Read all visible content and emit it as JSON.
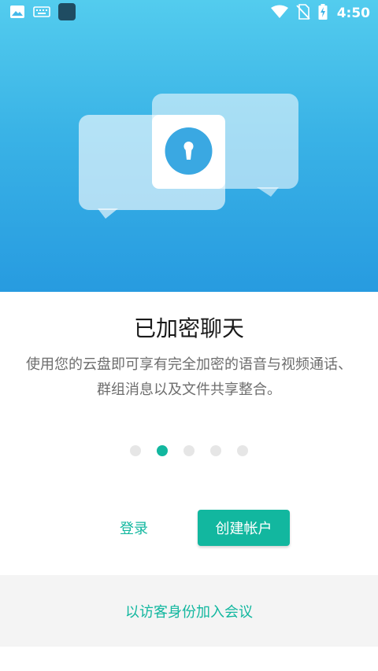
{
  "status_bar": {
    "time": "4:50",
    "left_icons": [
      "image-icon",
      "keyboard-icon",
      "app-square-icon"
    ],
    "right_icons": [
      "wifi-icon",
      "no-sim-icon",
      "battery-charging-icon"
    ]
  },
  "onboarding": {
    "title": "已加密聊天",
    "description": "使用您的云盘即可享有完全加密的语音与视频通话、群组消息以及文件共享整合。",
    "current_page": 2,
    "page_count": 5
  },
  "actions": {
    "login_label": "登录",
    "create_account_label": "创建帐户",
    "guest_join_label": "以访客身份加入会议"
  },
  "colors": {
    "accent": "#12b79f",
    "hero_top": "#53ccee",
    "hero_bottom": "#279be0"
  }
}
